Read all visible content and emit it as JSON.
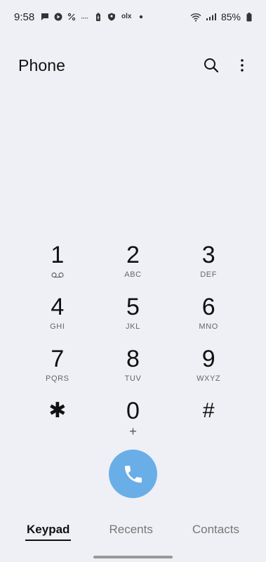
{
  "status_bar": {
    "time": "9:58",
    "battery_percent": "85%",
    "icons_left": [
      "message-icon",
      "play-icon",
      "percent-icon",
      "dots-icon",
      "battery-saver-icon",
      "shield-icon",
      "olx-icon",
      "dot-icon"
    ],
    "icons_right": [
      "wifi-icon",
      "signal-icon",
      "battery-icon"
    ]
  },
  "header": {
    "title": "Phone",
    "search_icon": "search-icon",
    "menu_icon": "more-vert-icon"
  },
  "keypad": {
    "keys": [
      {
        "digit": "1",
        "sub": ""
      },
      {
        "digit": "2",
        "sub": "ABC"
      },
      {
        "digit": "3",
        "sub": "DEF"
      },
      {
        "digit": "4",
        "sub": "GHI"
      },
      {
        "digit": "5",
        "sub": "JKL"
      },
      {
        "digit": "6",
        "sub": "MNO"
      },
      {
        "digit": "7",
        "sub": "PQRS"
      },
      {
        "digit": "8",
        "sub": "TUV"
      },
      {
        "digit": "9",
        "sub": "WXYZ"
      },
      {
        "digit": "✱",
        "sub": ""
      },
      {
        "digit": "0",
        "sub": "+"
      },
      {
        "digit": "#",
        "sub": ""
      }
    ]
  },
  "call_button": {
    "icon": "phone-icon",
    "color": "#6aaee8"
  },
  "tabs": [
    {
      "label": "Keypad",
      "active": true
    },
    {
      "label": "Recents",
      "active": false
    },
    {
      "label": "Contacts",
      "active": false
    }
  ],
  "colors": {
    "background": "#eef0f5",
    "accent": "#6aaee8",
    "text": "#111111"
  }
}
